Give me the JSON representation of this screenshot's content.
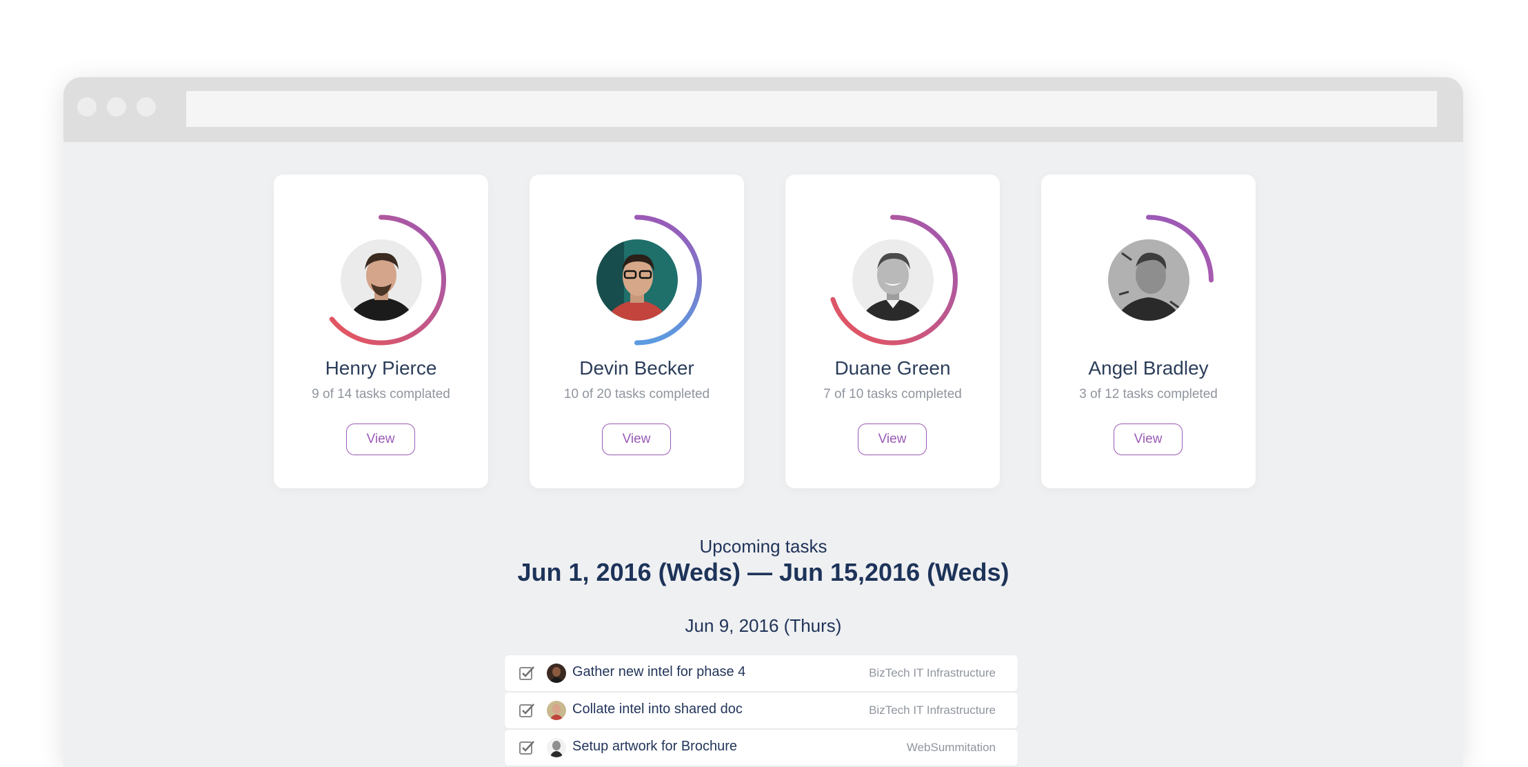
{
  "window": {
    "url": ""
  },
  "people": [
    {
      "name": "Henry Pierce",
      "stats": "9 of 14 tasks complated",
      "view_label": "View",
      "progress": 0.643,
      "avatar": "bearded-man-avatar"
    },
    {
      "name": "Devin Becker",
      "stats": "10 of 20 tasks completed",
      "view_label": "View",
      "progress": 0.5,
      "avatar": "man-with-glasses-avatar"
    },
    {
      "name": "Duane Green",
      "stats": "7 of 10 tasks completed",
      "view_label": "View",
      "progress": 0.7,
      "avatar": "smiling-man-avatar"
    },
    {
      "name": "Angel Bradley",
      "stats": "3 of 12 tasks completed",
      "view_label": "View",
      "progress": 0.25,
      "avatar": "monochrome-man-avatar"
    }
  ],
  "upcoming": {
    "label": "Upcoming tasks",
    "range": "Jun 1, 2016 (Weds) — Jun 15,2016 (Weds)",
    "day": "Jun 9, 2016 (Thurs)",
    "tasks": [
      {
        "title": "Gather new intel for phase 4",
        "project": "BizTech IT Infrastructure"
      },
      {
        "title": "Collate intel into shared doc",
        "project": "BizTech IT Infrastructure"
      },
      {
        "title": "Setup artwork for Brochure",
        "project": "WebSummitation"
      }
    ]
  },
  "colors": {
    "accent": "#9b59b6",
    "ring_start": "#e8555a",
    "ring_end": "#9b59b6",
    "ring_blue": "#5b9be0",
    "heading": "#1d3359",
    "muted": "#8f959e"
  }
}
